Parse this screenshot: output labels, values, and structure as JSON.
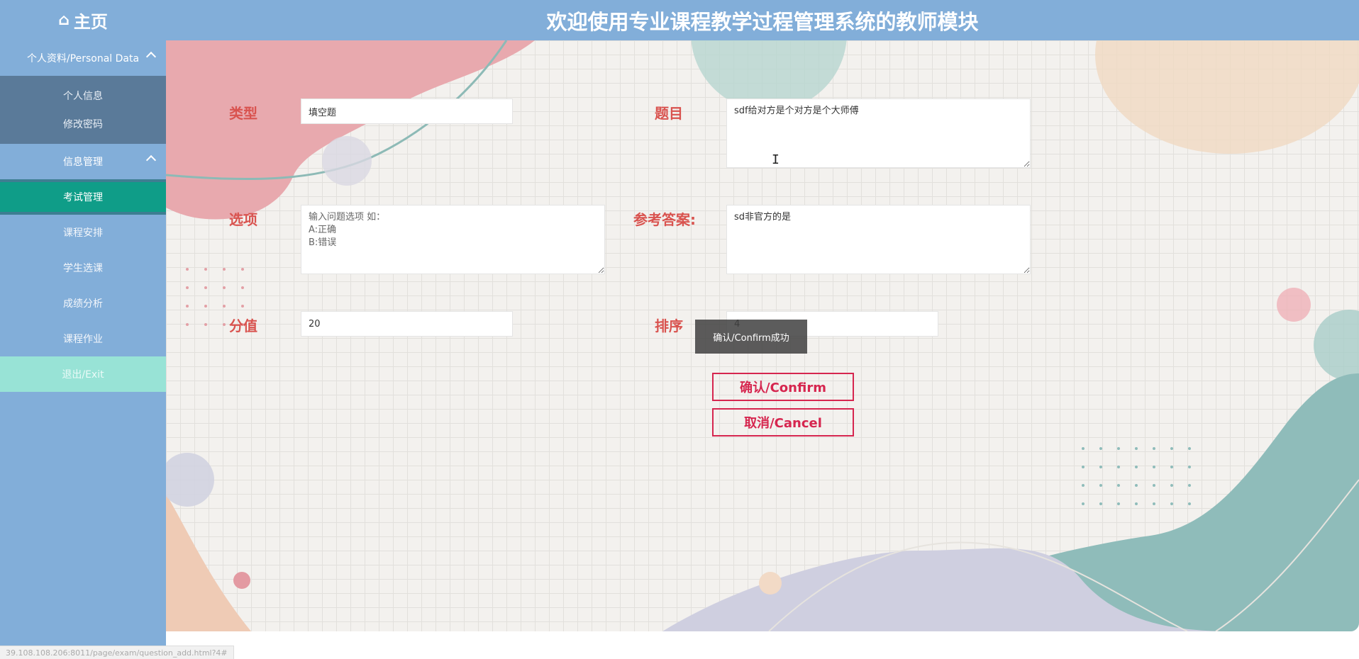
{
  "header": {
    "home_icon": "home-icon",
    "home_label": "主页",
    "title": "欢迎使用专业课程教学过程管理系统的教师模块"
  },
  "sidebar": {
    "group_personal": {
      "label": "个人资料/Personal Data",
      "items": [
        "个人信息",
        "修改密码"
      ]
    },
    "group_info": {
      "label": "信息管理"
    },
    "items": [
      {
        "label": "考试管理",
        "active": true
      },
      {
        "label": "课程安排"
      },
      {
        "label": "学生选课"
      },
      {
        "label": "成绩分析"
      },
      {
        "label": "课程作业"
      }
    ],
    "exit_label": "退出/Exit"
  },
  "form": {
    "type_label": "类型",
    "type_value": "填空题",
    "question_label": "题目",
    "question_value": "sdf给对方是个对方是个大师傅",
    "options_label": "选项",
    "options_placeholder": "输入问题选项 如：\nA:正确\nB:错误",
    "answer_label": "参考答案:",
    "answer_value": "sd非官方的是",
    "score_label": "分值",
    "score_value": "20",
    "order_label": "排序",
    "order_value": "4",
    "confirm_label": "确认/Confirm",
    "cancel_label": "取消/Cancel"
  },
  "toast": "确认/Confirm成功",
  "status_url": "39.108.108.206:8011/page/exam/question_add.html?4#",
  "colors": {
    "header_bg": "#82aed9",
    "active_item": "#0f9d88",
    "label_red": "#d9534f",
    "button_red": "#d6264f"
  }
}
